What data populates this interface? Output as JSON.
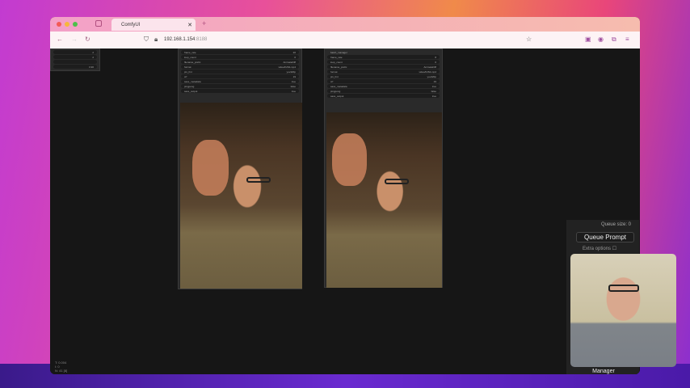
{
  "browser": {
    "tab_title": "ComfyUI",
    "url_host": "192.168.1.154",
    "url_port": ":8188"
  },
  "nodes": [
    {
      "title": "",
      "widgets": [
        [
          "frame_rate",
          "20"
        ],
        [
          "loop_count",
          "0"
        ],
        [
          "filename_prefix",
          "AnimateDiff"
        ],
        [
          "format",
          "video/h264-mp4"
        ],
        [
          "pix_fmt",
          "yuv420p"
        ],
        [
          "crf",
          "19"
        ],
        [
          "save_metadata",
          "true"
        ],
        [
          "pingpong",
          "false"
        ],
        [
          "save_output",
          "true"
        ]
      ]
    },
    {
      "title": "batch_manager",
      "widgets": [
        [
          "frame_rate",
          "8"
        ],
        [
          "loop_count",
          "0"
        ],
        [
          "filename_prefix",
          "AnimateDiff"
        ],
        [
          "format",
          "video/h264-mp4"
        ],
        [
          "pix_fmt",
          "yuv420p"
        ],
        [
          "crf",
          "19"
        ],
        [
          "save_metadata",
          "true"
        ],
        [
          "pingpong",
          "false"
        ],
        [
          "save_output",
          "true"
        ]
      ]
    }
  ],
  "left_node": {
    "values": [
      "2",
      "2",
      "",
      "0.90"
    ]
  },
  "sidebar": {
    "queue_size": "Queue size: 0",
    "queue_prompt": "Queue Prompt",
    "extra_options": "Extra options",
    "manager": "Manager"
  },
  "stats": [
    "T: 0.004",
    "I: 0",
    "N: 41 [8]"
  ]
}
